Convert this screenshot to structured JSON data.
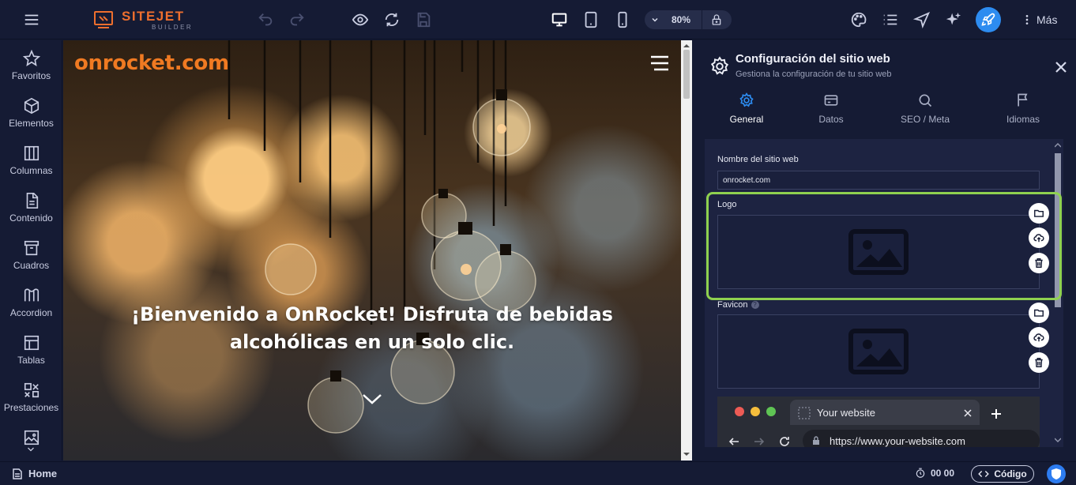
{
  "app": {
    "brand_main": "SITEJET",
    "brand_sub": "BUILDER",
    "zoom_level": "80%",
    "more_label": "Más"
  },
  "icons": {
    "topbar": [
      "menu-icon",
      "undo-icon",
      "redo-icon",
      "preview-eye-icon",
      "refresh-icon",
      "save-icon",
      "desktop-icon",
      "tablet-icon",
      "mobile-icon",
      "chevron-down-icon",
      "lock-icon",
      "palette-icon",
      "list-icon",
      "navigate-icon",
      "sparkle-ai-icon",
      "rocket-icon",
      "more-vertical-icon"
    ]
  },
  "sidebar": {
    "items": [
      {
        "label": "Favoritos",
        "icon": "star-icon"
      },
      {
        "label": "Elementos",
        "icon": "cube-icon"
      },
      {
        "label": "Columnas",
        "icon": "columns-icon"
      },
      {
        "label": "Contenido",
        "icon": "document-icon"
      },
      {
        "label": "Cuadros",
        "icon": "archive-icon"
      },
      {
        "label": "Accordion",
        "icon": "accordion-icon"
      },
      {
        "label": "Tablas",
        "icon": "table-icon"
      },
      {
        "label": "Prestaciones",
        "icon": "features-icon"
      }
    ]
  },
  "canvas": {
    "site_name": "onrocket.com",
    "hero_text": "¡Bienvenido a OnRocket! Disfruta de bebidas alcohólicas en un solo clic."
  },
  "panel": {
    "title": "Configuración del sitio web",
    "subtitle": "Gestiona la configuración de tu sitio web",
    "tabs": [
      {
        "label": "General",
        "icon": "gear-icon",
        "active": true
      },
      {
        "label": "Datos",
        "icon": "card-icon",
        "active": false
      },
      {
        "label": "SEO / Meta",
        "icon": "search-icon",
        "active": false
      },
      {
        "label": "Idiomas",
        "icon": "flag-icon",
        "active": false
      }
    ],
    "site_name_label": "Nombre del sitio web",
    "site_name_value": "onrocket.com",
    "logo_label": "Logo",
    "favicon_label": "Favicon",
    "browser_preview": {
      "tab_title": "Your website",
      "url": "https://www.your-website.com"
    }
  },
  "statusbar": {
    "page": "Home",
    "time": "00 00",
    "code_label": "Código"
  },
  "colors": {
    "accent_orange": "#ee6f2e",
    "highlight_green": "#8fd14f",
    "primary_blue": "#2d8cf0",
    "dark_bg": "#151b34"
  }
}
